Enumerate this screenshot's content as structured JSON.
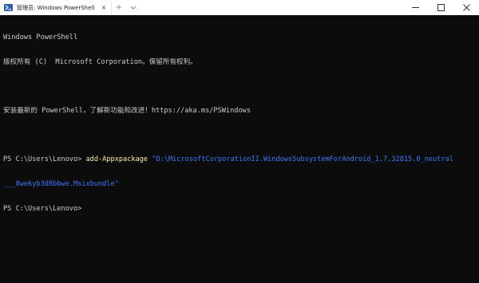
{
  "window": {
    "tab_title": "管理员: Windows PowerShell",
    "tab_icon": "powershell-icon",
    "tab_close": "×",
    "new_tab": "+",
    "dropdown": "⌄",
    "minimize": "minimize-icon",
    "maximize": "maximize-icon",
    "close": "close-icon"
  },
  "console": {
    "lines": [
      "Windows PowerShell",
      "版权所有 (C)  Microsoft Corporation。保留所有权利。",
      "",
      "安装最新的 PowerShell，了解新功能和改进！https://aka.ms/PSWindows",
      ""
    ],
    "prompt1": "PS C:\\Users\\Lenovo> ",
    "command": "add-Appxpackage",
    "argument_part1": " \"D:\\MicrosoftCorporationII.WindowsSubsystemForAndroid_1.7.32815.0_neutral",
    "argument_part2": "___8wekyb3d8bbwe.Msixbundle\"",
    "prompt2": "PS C:\\Users\\Lenovo>"
  },
  "colors": {
    "background": "#0c0c0c",
    "text": "#cccccc",
    "command": "#f9f1a5",
    "argument": "#3b78ff"
  }
}
